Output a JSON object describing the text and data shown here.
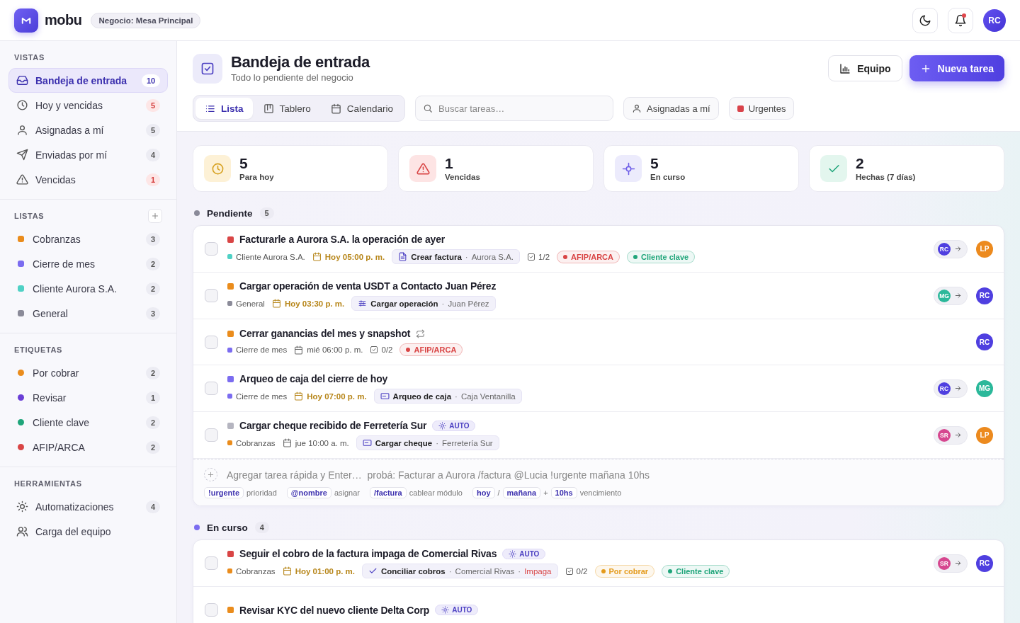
{
  "header": {
    "brand": "mobu",
    "business": "Negocio: Mesa Principal",
    "notifications": {
      "unread": true
    },
    "user": {
      "initials": "RC"
    }
  },
  "sidebar": {
    "sections": [
      {
        "title": "VISTAS",
        "kind": "views",
        "add_button": false,
        "items": [
          {
            "label": "Bandeja de entrada",
            "count": "10",
            "selected": true,
            "alert": false
          },
          {
            "label": "Hoy y vencidas",
            "count": "5",
            "selected": false,
            "alert": true
          },
          {
            "label": "Asignadas a mí",
            "count": "5",
            "selected": false,
            "alert": false
          },
          {
            "label": "Enviadas por mí",
            "count": "4",
            "selected": false,
            "alert": false
          },
          {
            "label": "Vencidas",
            "count": "1",
            "selected": false,
            "alert": true
          }
        ]
      },
      {
        "title": "LISTAS",
        "kind": "lists",
        "add_button": true,
        "items": [
          {
            "label": "Cobranzas",
            "count": "3",
            "color": "#ea8c1c",
            "selected": false
          },
          {
            "label": "Cierre de mes",
            "count": "2",
            "color": "#7b6cf0",
            "selected": false
          },
          {
            "label": "Cliente Aurora S.A.",
            "count": "2",
            "color": "#4fd1c5",
            "selected": false
          },
          {
            "label": "General",
            "count": "3",
            "color": "#8b8b99",
            "selected": false
          }
        ]
      },
      {
        "title": "ETIQUETAS",
        "kind": "tags",
        "add_button": false,
        "items": [
          {
            "label": "Por cobrar",
            "count": "2",
            "color": "#ea8c1c",
            "selected": false
          },
          {
            "label": "Revisar",
            "count": "1",
            "color": "#6a3fd6",
            "selected": false
          },
          {
            "label": "Cliente clave",
            "count": "2",
            "color": "#1fa57a",
            "selected": false
          },
          {
            "label": "AFIP/ARCA",
            "count": "2",
            "color": "#d94545",
            "selected": false
          }
        ]
      },
      {
        "title": "HERRAMIENTAS",
        "kind": "tools",
        "add_button": false,
        "items": [
          {
            "label": "Automatizaciones",
            "count": "4",
            "selected": false
          },
          {
            "label": "Carga del equipo",
            "selected": false
          }
        ]
      }
    ]
  },
  "page": {
    "title": "Bandeja de entrada",
    "subtitle": "Todo lo pendiente del negocio",
    "buttons": [
      {
        "label": "Equipo",
        "kind": "secondary"
      },
      {
        "label": "Nueva tarea",
        "kind": "primary"
      }
    ],
    "view_tabs": [
      {
        "label": "Lista",
        "selected": true
      },
      {
        "label": "Tablero",
        "selected": false
      },
      {
        "label": "Calendario",
        "selected": false
      }
    ],
    "search": {
      "placeholder": "Buscar tareas…"
    },
    "filters": [
      {
        "label": "Asignadas a mí",
        "kind": "person"
      },
      {
        "label": "Urgentes",
        "kind": "urgent"
      }
    ]
  },
  "stats": [
    {
      "value": "5",
      "label": "Para hoy",
      "kind": "today"
    },
    {
      "value": "1",
      "label": "Vencidas",
      "kind": "overdue"
    },
    {
      "value": "5",
      "label": "En curso",
      "kind": "progress"
    },
    {
      "value": "2",
      "label": "Hechas (7 días)",
      "kind": "done"
    }
  ],
  "groups": [
    {
      "title": "Pendiente",
      "count": "5",
      "color": "#8a8a99",
      "tasks": [
        {
          "title": "Facturarle a Aurora S.A. la operación de ayer",
          "priority": {
            "color": "#d94545"
          },
          "recurring": false,
          "done": false,
          "list": {
            "name": "Cliente Aurora S.A.",
            "color": "#4fd1c5"
          },
          "due": {
            "text": "Hoy 05:00 p. m.",
            "today": true
          },
          "module": {
            "kind": "invoice",
            "name": "Crear factura",
            "sep": "·",
            "target": "Aurora S.A."
          },
          "checklist": "1/2",
          "tags": [
            {
              "label": "AFIP/ARCA",
              "color": "#d94545"
            },
            {
              "label": "Cliente clave",
              "color": "#1fa57a"
            }
          ],
          "assignees": {
            "from": {
              "initials": "RC",
              "color": "#4f3fe0"
            },
            "to": {
              "initials": "LP",
              "color": "#ec8a1e"
            }
          }
        },
        {
          "title": "Cargar operación de venta USDT a Contacto Juan Pérez",
          "priority": {
            "color": "#ea8c1c"
          },
          "recurring": false,
          "done": false,
          "list": {
            "name": "General",
            "color": "#8b8b99"
          },
          "due": {
            "text": "Hoy 03:30 p. m.",
            "today": true
          },
          "module": {
            "kind": "operation",
            "name": "Cargar operación",
            "sep": "·",
            "target": "Juan Pérez"
          },
          "assignees": {
            "from": {
              "initials": "MG",
              "color": "#2bb89a"
            },
            "to": {
              "initials": "RC",
              "color": "#4f3fe0"
            }
          }
        },
        {
          "title": "Cerrar ganancias del mes y snapshot",
          "priority": {
            "color": "#ea8c1c"
          },
          "recurring": true,
          "done": false,
          "list": {
            "name": "Cierre de mes",
            "color": "#7b6cf0"
          },
          "due": {
            "text": "mié 06:00 p. m.",
            "today": false
          },
          "checklist": "0/2",
          "tags": [
            {
              "label": "AFIP/ARCA",
              "color": "#d94545"
            }
          ],
          "assignees": {
            "to": {
              "initials": "RC",
              "color": "#4f3fe0"
            }
          }
        },
        {
          "title": "Arqueo de caja del cierre de hoy",
          "priority": {
            "color": "#7b6cf0"
          },
          "recurring": false,
          "done": false,
          "list": {
            "name": "Cierre de mes",
            "color": "#7b6cf0"
          },
          "due": {
            "text": "Hoy 07:00 p. m.",
            "today": true
          },
          "module": {
            "kind": "cash",
            "name": "Arqueo de caja",
            "sep": "·",
            "target": "Caja Ventanilla"
          },
          "assignees": {
            "from": {
              "initials": "RC",
              "color": "#4f3fe0"
            },
            "to": {
              "initials": "MG",
              "color": "#2bb89a"
            }
          }
        },
        {
          "title": "Cargar cheque recibido de Ferretería Sur",
          "priority": {
            "color": "#b5b5c0"
          },
          "auto": "AUTO",
          "recurring": false,
          "done": false,
          "list": {
            "name": "Cobranzas",
            "color": "#ea8c1c"
          },
          "due": {
            "text": "jue 10:00 a. m.",
            "today": false
          },
          "module": {
            "kind": "cheque",
            "name": "Cargar cheque",
            "sep": "·",
            "target": "Ferretería Sur"
          },
          "assignees": {
            "from": {
              "initials": "SR",
              "color": "#d6478f"
            },
            "to": {
              "initials": "LP",
              "color": "#ec8a1e"
            }
          }
        }
      ],
      "quick_add": {
        "placeholder": "Agregar tarea rápida y Enter…  probá: Facturar a Aurora /factura @Lucia !urgente mañana 10hs",
        "hints": [
          {
            "kind": "token",
            "text": "!urgente"
          },
          {
            "kind": "text",
            "text": "prioridad"
          },
          {
            "kind": "token",
            "text": "@nombre"
          },
          {
            "kind": "text",
            "text": "asignar"
          },
          {
            "kind": "token",
            "text": "/factura"
          },
          {
            "kind": "text",
            "text": "cablear módulo"
          },
          {
            "kind": "token",
            "text": "hoy"
          },
          {
            "kind": "sep",
            "text": "/"
          },
          {
            "kind": "token",
            "text": "mañana"
          },
          {
            "kind": "sep",
            "text": "+"
          },
          {
            "kind": "token",
            "text": "10hs"
          },
          {
            "kind": "text",
            "text": "vencimiento"
          }
        ]
      }
    },
    {
      "title": "En curso",
      "count": "4",
      "color": "#7b6cf0",
      "tasks": [
        {
          "title": "Seguir el cobro de la factura impaga de Comercial Rivas",
          "priority": {
            "color": "#d94545"
          },
          "auto": "AUTO",
          "recurring": false,
          "done": false,
          "list": {
            "name": "Cobranzas",
            "color": "#ea8c1c"
          },
          "due": {
            "text": "Hoy 01:00 p. m.",
            "today": true
          },
          "module": {
            "kind": "reconcile",
            "name": "Conciliar cobros",
            "sep": "·",
            "target": "Comercial Rivas",
            "status_sep": "·",
            "status": "Impaga"
          },
          "checklist": "0/2",
          "tags": [
            {
              "label": "Por cobrar",
              "color": "#e49a1a"
            },
            {
              "label": "Cliente clave",
              "color": "#1fa57a"
            }
          ],
          "assignees": {
            "from": {
              "initials": "SR",
              "color": "#d6478f"
            },
            "to": {
              "initials": "RC",
              "color": "#4f3fe0"
            }
          }
        },
        {
          "title": "Revisar KYC del nuevo cliente Delta Corp",
          "priority": {
            "color": "#ea8c1c"
          },
          "auto": "AUTO",
          "recurring": false,
          "done": false
        }
      ]
    }
  ]
}
